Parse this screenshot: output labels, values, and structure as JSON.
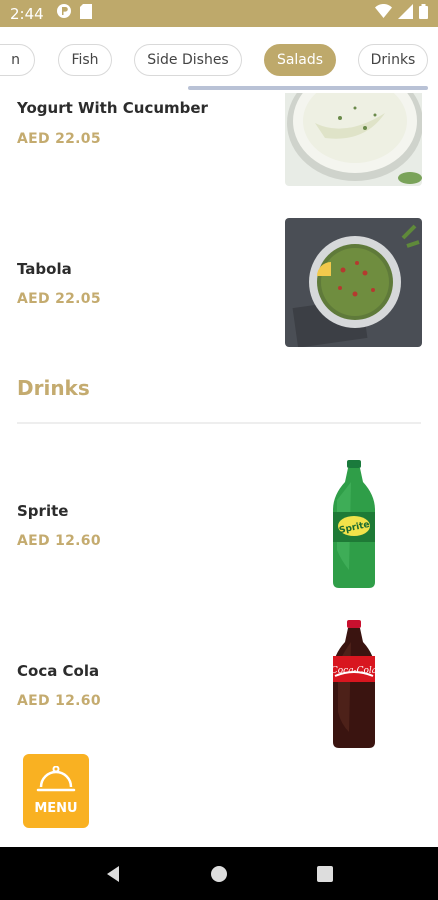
{
  "status_bar": {
    "time": "2:44",
    "icons": [
      "notification-icon",
      "sim-icon",
      "wifi-icon",
      "signal-icon",
      "battery-icon"
    ]
  },
  "tabs": [
    {
      "label": "n",
      "active": false
    },
    {
      "label": "Fish",
      "active": false
    },
    {
      "label": "Side Dishes",
      "active": false
    },
    {
      "label": "Salads",
      "active": true
    },
    {
      "label": "Drinks",
      "active": false
    }
  ],
  "items": [
    {
      "name": "Yogurt With Cucumber",
      "price": "AED 22.05",
      "image": "yogurt-cucumber-image"
    },
    {
      "name": "Tabola",
      "price": "AED 22.05",
      "image": "tabola-image"
    }
  ],
  "drinks_section": {
    "title": "Drinks",
    "items": [
      {
        "name": "Sprite",
        "price": "AED 12.60",
        "image": "sprite-bottle-image"
      },
      {
        "name": "Coca Cola",
        "price": "AED 12.60",
        "image": "coca-cola-bottle-image"
      }
    ]
  },
  "menu_button": {
    "label": "MENU",
    "icon": "cloche-icon"
  },
  "nav_bar": {
    "buttons": [
      "back-icon",
      "home-icon",
      "recents-icon"
    ]
  },
  "colors": {
    "accent": "#bea96b",
    "price": "#c4ab6f",
    "menu_button": "#f9b122"
  }
}
